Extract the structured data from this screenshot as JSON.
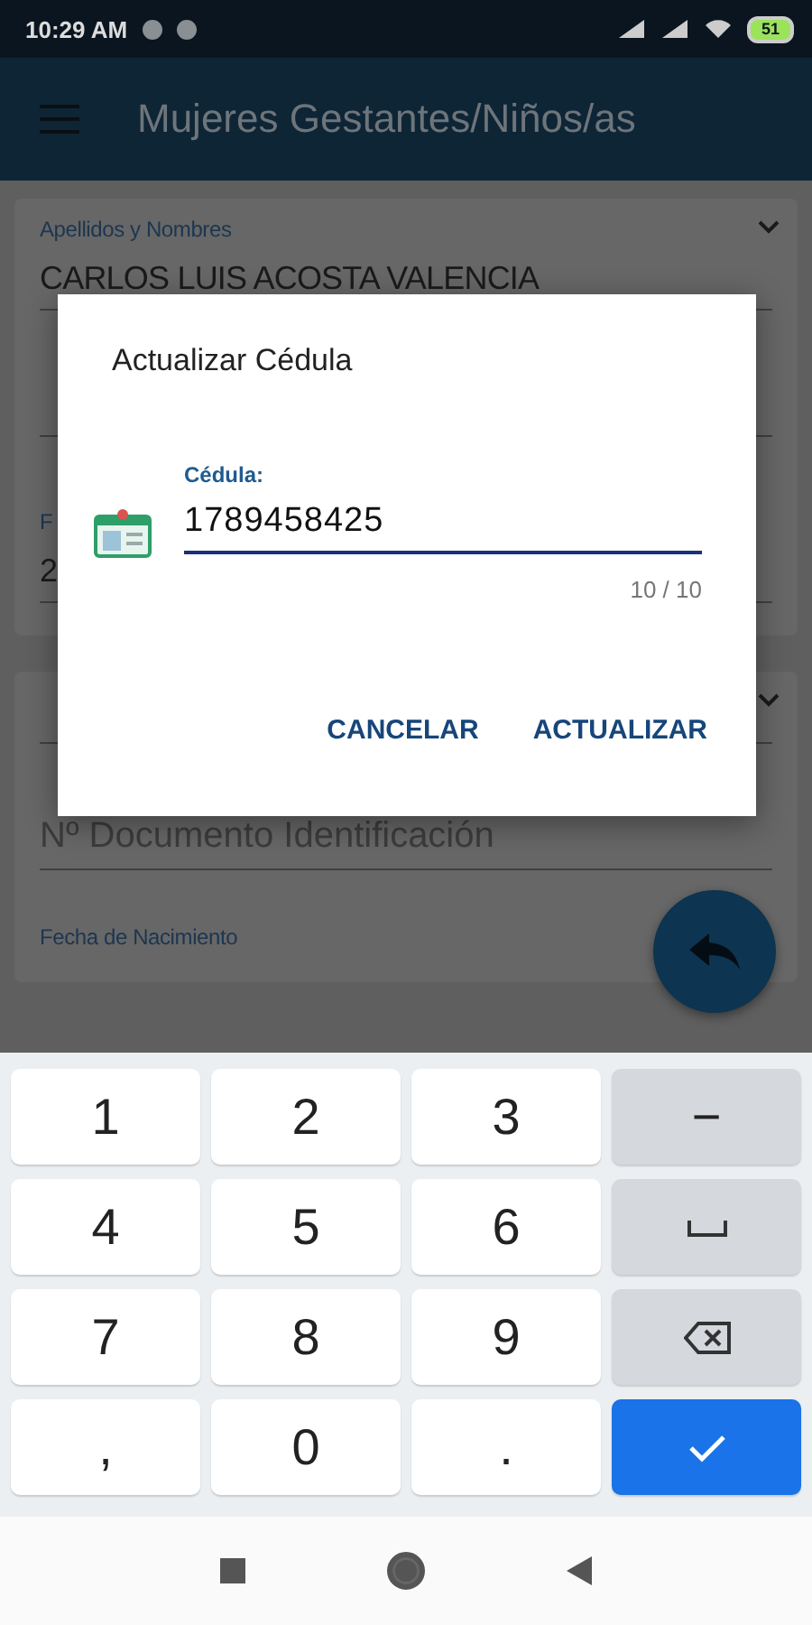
{
  "status_bar": {
    "time": "10:29 AM",
    "battery": "51"
  },
  "app_bar": {
    "title": "Mujeres Gestantes/Niños/as"
  },
  "cards": [
    {
      "fields": [
        {
          "kind": "filled",
          "label": "Apellidos y Nombres",
          "value": "CARLOS LUIS ACOSTA VALENCIA"
        },
        {
          "kind": "empty"
        },
        {
          "kind": "filled",
          "label": "F",
          "value": "2"
        }
      ]
    },
    {
      "fields": [
        {
          "kind": "empty"
        },
        {
          "kind": "empty",
          "placeholder": "Nº Documento Identificación"
        },
        {
          "kind": "label",
          "label": "Fecha de Nacimiento"
        }
      ]
    }
  ],
  "dialog": {
    "title": "Actualizar Cédula",
    "field": {
      "label": "Cédula:",
      "value": "1789458425",
      "counter": "10 / 10"
    },
    "buttons": [
      "CANCELAR",
      "ACTUALIZAR"
    ]
  },
  "keyboard": {
    "keys": [
      {
        "kind": "digit",
        "label": "1"
      },
      {
        "kind": "digit",
        "label": "2"
      },
      {
        "kind": "digit",
        "label": "3"
      },
      {
        "kind": "symbol",
        "label": "−"
      },
      {
        "kind": "digit",
        "label": "4"
      },
      {
        "kind": "digit",
        "label": "5"
      },
      {
        "kind": "digit",
        "label": "6"
      },
      {
        "kind": "space"
      },
      {
        "kind": "digit",
        "label": "7"
      },
      {
        "kind": "digit",
        "label": "8"
      },
      {
        "kind": "digit",
        "label": "9"
      },
      {
        "kind": "backspace"
      },
      {
        "kind": "digit",
        "label": ","
      },
      {
        "kind": "digit",
        "label": "0"
      },
      {
        "kind": "digit",
        "label": "."
      },
      {
        "kind": "done"
      }
    ]
  }
}
